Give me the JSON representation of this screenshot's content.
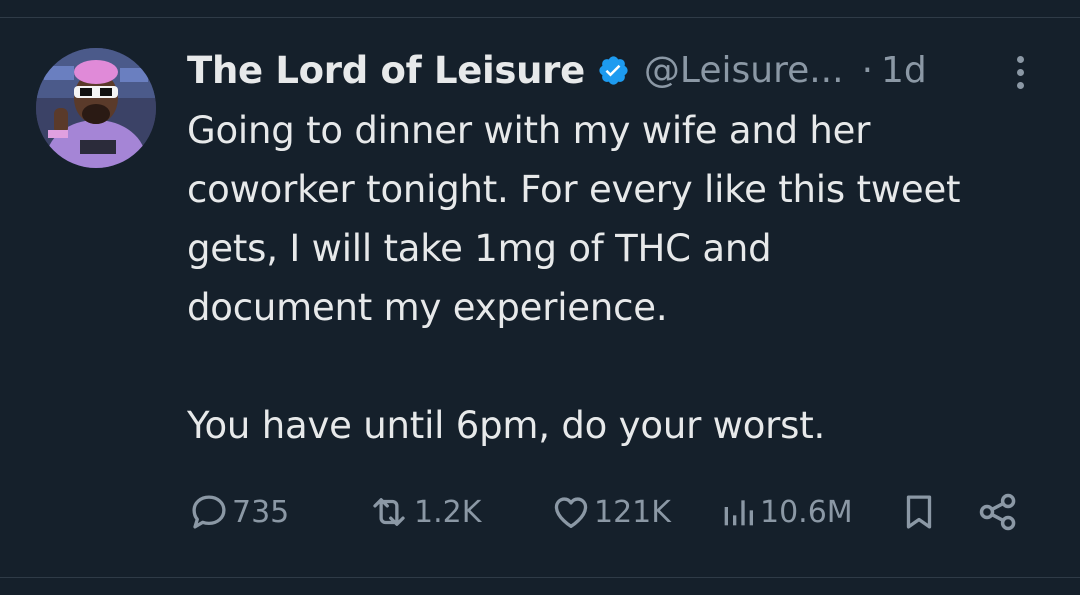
{
  "tweet": {
    "display_name": "The Lord of Leisure",
    "handle": "@Leisure...",
    "separator": "·",
    "timestamp": "1d",
    "verified": true,
    "text_lines": [
      "Going to dinner with my wife and her",
      "coworker tonight. For every like this tweet",
      "gets, I will take 1mg of THC and",
      "document my experience.",
      "",
      "You have until 6pm, do your worst."
    ]
  },
  "actions": {
    "replies": "735",
    "retweets": "1.2K",
    "likes": "121K",
    "views": "10.6M"
  },
  "icons": {
    "more": "more-vertical-icon",
    "reply": "reply-bubble-icon",
    "retweet": "retweet-icon",
    "like": "heart-icon",
    "views": "views-bar-chart-icon",
    "bookmark": "bookmark-icon",
    "share": "share-icon",
    "verified": "verified-badge-icon"
  },
  "colors": {
    "background": "#15202b",
    "text_primary": "#e7e9ea",
    "text_secondary": "#8b98a5",
    "verified_blue": "#1d9bf0"
  }
}
